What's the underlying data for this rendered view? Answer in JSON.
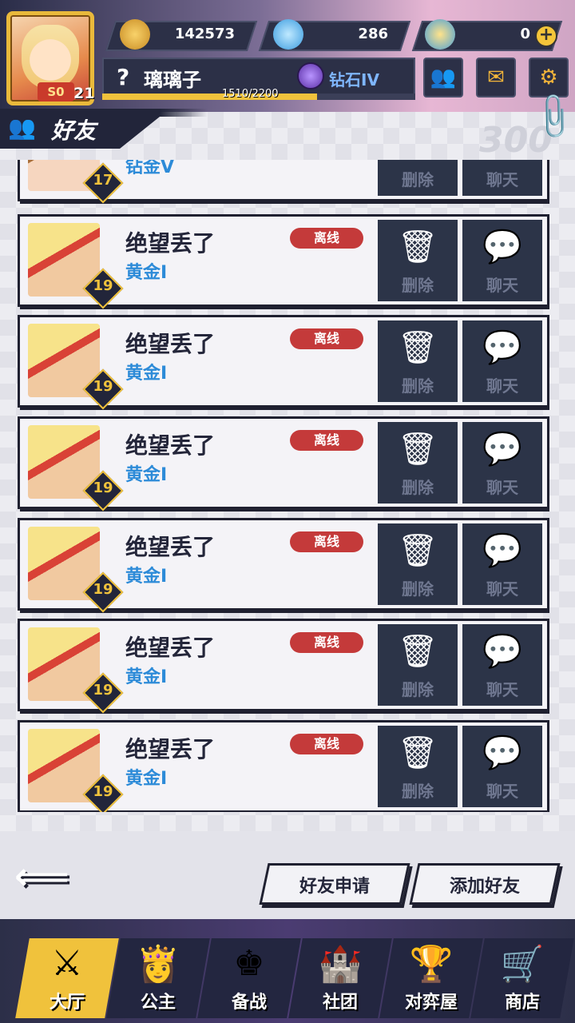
{
  "player": {
    "avatar_badge": "S0",
    "level": "21",
    "name_prefix": "?",
    "name": "璃璃子",
    "rank": "钻石IV",
    "xp_text": "1510/2200",
    "xp_fraction": 0.686
  },
  "resources": [
    {
      "icon": "gold-coin-icon",
      "value": "142573"
    },
    {
      "icon": "diamond-icon",
      "value": "286"
    },
    {
      "icon": "special-coin-icon",
      "value": "0"
    }
  ],
  "top_buttons": [
    {
      "icon": "friends-icon",
      "glyph": "👥"
    },
    {
      "icon": "mail-icon",
      "glyph": "✉"
    },
    {
      "icon": "settings-icon",
      "glyph": "⚙"
    }
  ],
  "header": {
    "title": "好友",
    "deco": "300"
  },
  "friends": [
    {
      "name": "",
      "rank": "钻金V",
      "level": "17",
      "status": "",
      "avatar": "girl",
      "partial": true
    },
    {
      "name": "绝望丢了",
      "rank": "黄金I",
      "level": "19",
      "status": "离线",
      "avatar": "boy"
    },
    {
      "name": "绝望丢了",
      "rank": "黄金I",
      "level": "19",
      "status": "离线",
      "avatar": "boy"
    },
    {
      "name": "绝望丢了",
      "rank": "黄金I",
      "level": "19",
      "status": "离线",
      "avatar": "boy"
    },
    {
      "name": "绝望丢了",
      "rank": "黄金I",
      "level": "19",
      "status": "离线",
      "avatar": "boy"
    },
    {
      "name": "绝望丢了",
      "rank": "黄金I",
      "level": "19",
      "status": "离线",
      "avatar": "boy"
    },
    {
      "name": "绝望丢了",
      "rank": "黄金I",
      "level": "19",
      "status": "离线",
      "avatar": "boy"
    }
  ],
  "card_actions": {
    "delete_label": "删除",
    "chat_label": "聊天"
  },
  "bottom_actions": {
    "friend_requests": "好友申请",
    "add_friend": "添加好友"
  },
  "nav": [
    {
      "label": "大厅",
      "icon": "lobby-icon",
      "glyph": "⚔",
      "active": true
    },
    {
      "label": "公主",
      "icon": "princess-icon",
      "glyph": "👸",
      "active": false
    },
    {
      "label": "备战",
      "icon": "chess-icon",
      "glyph": "♚",
      "active": false
    },
    {
      "label": "社团",
      "icon": "guild-icon",
      "glyph": "🏰",
      "active": false
    },
    {
      "label": "对弈屋",
      "icon": "arena-icon",
      "glyph": "🏆",
      "active": false
    },
    {
      "label": "商店",
      "icon": "shop-icon",
      "glyph": "🛒",
      "active": false
    }
  ],
  "colors": {
    "accent": "#f0c23c",
    "offline": "#c43a3a",
    "rank_blue": "#2d8bd8",
    "panel_dark": "#2c3448"
  }
}
